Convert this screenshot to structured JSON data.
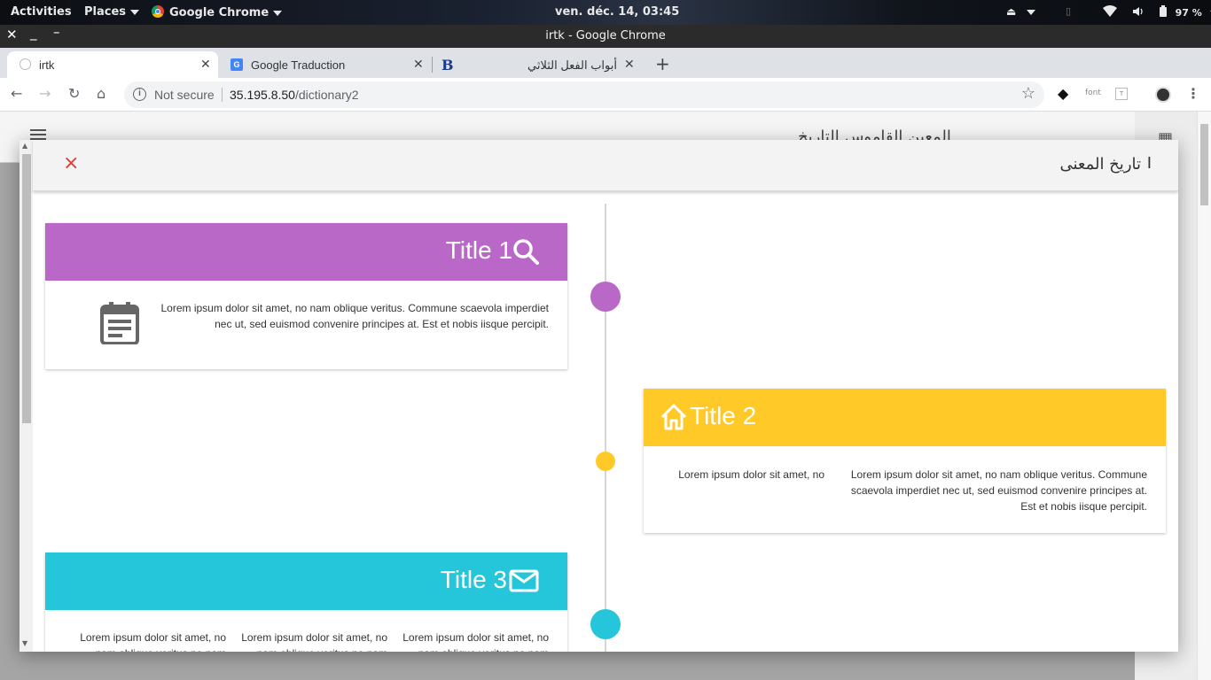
{
  "topbar": {
    "activities": "Activities",
    "places": "Places",
    "app": "Google Chrome",
    "clock": "ven. déc. 14, 03:45",
    "battery": "97 %"
  },
  "window": {
    "title": "irtk - Google Chrome"
  },
  "tabs": [
    {
      "label": "irtk",
      "active": true
    },
    {
      "label": "Google Traduction",
      "active": false
    },
    {
      "label": "أبواب الفعل الثلاثي",
      "active": false
    }
  ],
  "omnibox": {
    "security": "Not secure",
    "host": "35.195.8.50",
    "path": "/dictionary2"
  },
  "extensions": {
    "font_label": "font"
  },
  "background_page": {
    "title": "المعين القاموس التاريخ"
  },
  "modal": {
    "title": "تاريخ المعنى",
    "close_glyph": "×"
  },
  "timeline": [
    {
      "title": "Title 1",
      "icon": "search-icon",
      "color": "#ba68c8",
      "side": "left",
      "body": "Lorem ipsum dolor sit amet, no nam oblique veritus. Commune scaevola imperdiet nec ut, sed euismod convenire principes at. Est et nobis iisque percipit."
    },
    {
      "title": "Title 2",
      "icon": "home-icon",
      "color": "#ffca28",
      "side": "right",
      "body_a": "Lorem ipsum dolor sit amet, no nam oblique veritus. Commune scaevola imperdiet nec ut, sed euismod convenire principes at. Est et nobis iisque percipit.",
      "body_b": "Lorem ipsum dolor sit amet, no"
    },
    {
      "title": "Title 3",
      "icon": "mail-icon",
      "color": "#26c6da",
      "side": "left",
      "columns": [
        "Lorem ipsum dolor sit amet, no nam oblique veritus no nam",
        "Lorem ipsum dolor sit amet, no nam oblique veritus no nam",
        "Lorem ipsum dolor sit amet, no nam oblique veritus no nam"
      ]
    }
  ]
}
